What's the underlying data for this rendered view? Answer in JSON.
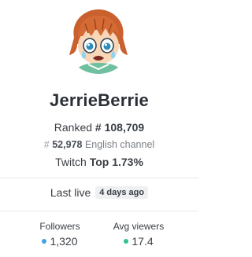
{
  "profile": {
    "username": "JerrieBerrie",
    "avatar_icon": "avatar-image"
  },
  "rank": {
    "label": "Ranked",
    "value": "# 108,709"
  },
  "channel": {
    "hash": "#",
    "value": "52,978",
    "label": "English channel"
  },
  "twitch": {
    "label": "Twitch",
    "value": "Top 1.73%"
  },
  "last_live": {
    "label": "Last live",
    "value": "4 days ago"
  },
  "stats": {
    "followers_label": "Followers",
    "followers_value": "1,320",
    "followers_color": "#3fa1e0",
    "avg_viewers_label": "Avg viewers",
    "avg_viewers_value": "17.4",
    "avg_viewers_color": "#34c08a"
  }
}
